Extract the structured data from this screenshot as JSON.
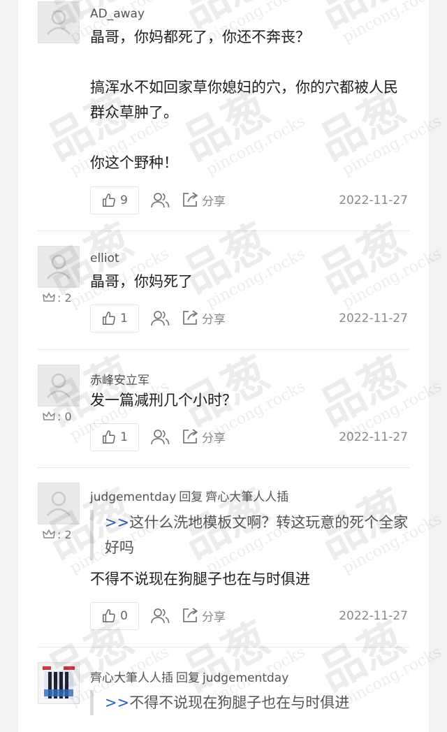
{
  "comments": [
    {
      "author": "AD_away",
      "paragraphs": [
        "晶哥，你妈都死了，你还不奔丧？",
        "搞浑水不如回家草你媳妇的穴，你的穴都被人民群众草肿了。",
        "你这个野种！"
      ],
      "likes": "9",
      "share_label": "分享",
      "date": "2022-11-27"
    },
    {
      "author": "elliot",
      "rank": ": 2",
      "text": "晶哥，你妈死了",
      "likes": "1",
      "share_label": "分享",
      "date": "2022-11-27"
    },
    {
      "author": "赤峰安立军",
      "rank": ": 0",
      "text": "发一篇减刑几个小时？",
      "likes": "1",
      "share_label": "分享",
      "date": "2022-11-27"
    },
    {
      "author": "judgementday",
      "reply_word": "回复",
      "reply_to": "齊心大筆人人插",
      "rank": ": 2",
      "quote_marker": ">>",
      "quote": "这什么洗地模板文啊？转这玩意的死个全家好吗",
      "text": "不得不说现在狗腿子也在与时俱进",
      "likes": "0",
      "share_label": "分享",
      "date": "2022-11-27"
    },
    {
      "author": "齊心大筆人人插",
      "reply_word": "回复",
      "reply_to": "judgementday",
      "quote_marker": ">>",
      "quote": "不得不说现在狗腿子也在与时俱进"
    }
  ],
  "watermark": {
    "main": "品葱",
    "sub": "pincong.rocks"
  },
  "colors": {
    "quote_marker": "#2a62c0",
    "background": "#f2f2f2",
    "panel": "#ffffff"
  }
}
